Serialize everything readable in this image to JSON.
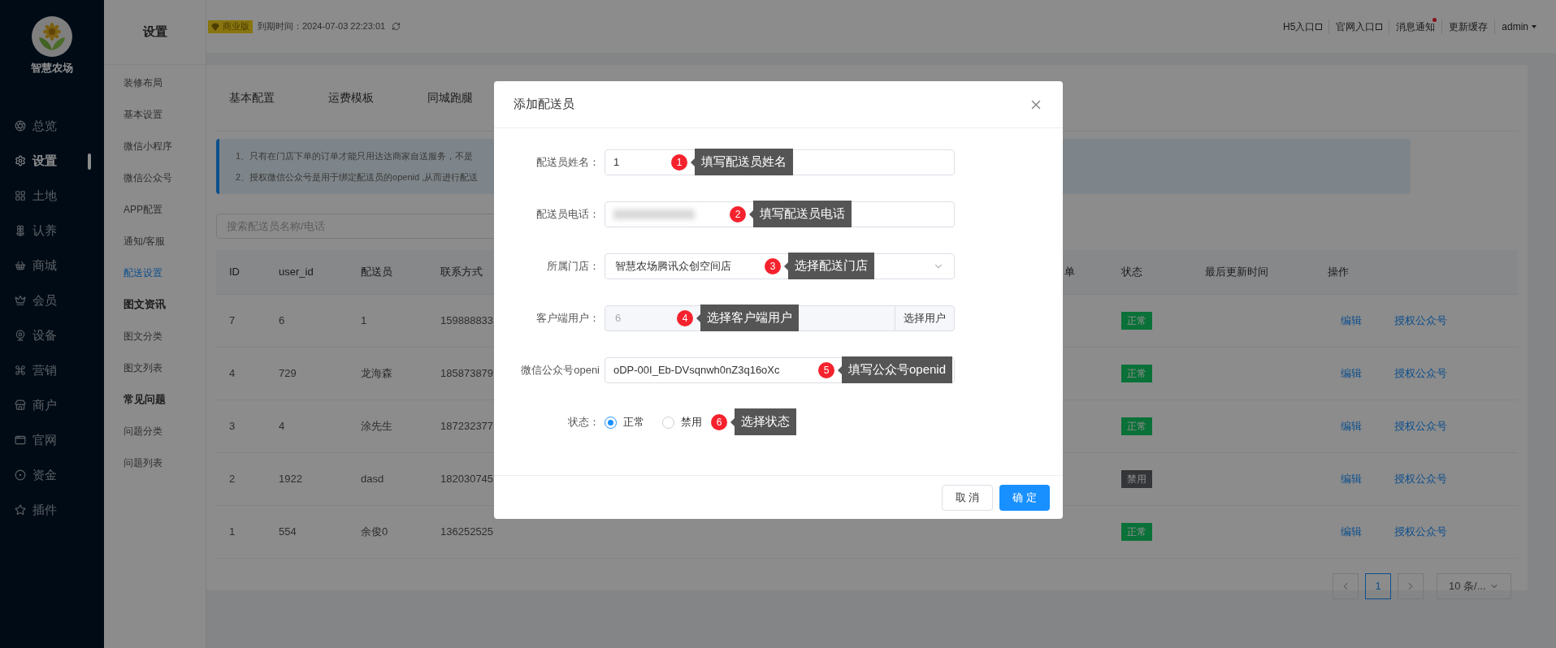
{
  "sidebar": {
    "logo_text": "智慧农场",
    "items": [
      {
        "label": "总览",
        "selected": false
      },
      {
        "label": "设置",
        "selected": true
      },
      {
        "label": "土地",
        "selected": false
      },
      {
        "label": "认养",
        "selected": false
      },
      {
        "label": "商城",
        "selected": false
      },
      {
        "label": "会员",
        "selected": false
      },
      {
        "label": "设备",
        "selected": false
      },
      {
        "label": "营销",
        "selected": false
      },
      {
        "label": "商户",
        "selected": false
      },
      {
        "label": "官网",
        "selected": false
      },
      {
        "label": "资金",
        "selected": false
      },
      {
        "label": "插件",
        "selected": false
      }
    ]
  },
  "submenu": {
    "title": "设置",
    "items": [
      {
        "label": "装修布局",
        "kind": "link",
        "selected": false
      },
      {
        "label": "基本设置",
        "kind": "link",
        "selected": false
      },
      {
        "label": "微信小程序",
        "kind": "link",
        "selected": false
      },
      {
        "label": "微信公众号",
        "kind": "link",
        "selected": false
      },
      {
        "label": "APP配置",
        "kind": "link",
        "selected": false
      },
      {
        "label": "通知/客服",
        "kind": "link",
        "selected": false
      },
      {
        "label": "配送设置",
        "kind": "link",
        "selected": true
      },
      {
        "label": "图文资讯",
        "kind": "heading",
        "selected": false
      },
      {
        "label": "图文分类",
        "kind": "link",
        "selected": false
      },
      {
        "label": "图文列表",
        "kind": "link",
        "selected": false
      },
      {
        "label": "常见问题",
        "kind": "heading",
        "selected": false
      },
      {
        "label": "问题分类",
        "kind": "link",
        "selected": false
      },
      {
        "label": "问题列表",
        "kind": "link",
        "selected": false
      }
    ]
  },
  "top_bar": {
    "edition_badge": "商业版",
    "expiry": "到期时间：2024-07-03 22:23:01",
    "links": [
      {
        "label": "H5入口",
        "kind": "external",
        "dot": false
      },
      {
        "label": "官网入口",
        "kind": "external",
        "dot": false
      },
      {
        "label": "消息通知",
        "kind": "plain",
        "dot": true
      },
      {
        "label": "更新缓存",
        "kind": "plain",
        "dot": false
      }
    ],
    "user": "admin"
  },
  "tabs": [
    {
      "label": "基本配置"
    },
    {
      "label": "运费模板"
    },
    {
      "label": "同城跑腿"
    }
  ],
  "notice": [
    "1、只有在门店下单的订单才能只用达达商家自送服务，不是",
    "2、授权微信公众号是用于绑定配送员的openid ,从而进行配送"
  ],
  "search": {
    "placeholder": "搜索配送员名称/电话"
  },
  "table": {
    "columns": [
      "ID",
      "user_id",
      "配送员",
      "联系方式",
      "单",
      "状态",
      "最后更新时间",
      "操作"
    ],
    "rows": [
      {
        "id": "7",
        "user_id": "6",
        "name": "1",
        "phone": "159888833",
        "status": {
          "label": "正常",
          "kind": "normal"
        },
        "actions": [
          "编辑",
          "授权公众号"
        ]
      },
      {
        "id": "4",
        "user_id": "729",
        "name": "龙海森",
        "phone": "185873879",
        "status": {
          "label": "正常",
          "kind": "normal"
        },
        "actions": [
          "编辑",
          "授权公众号"
        ]
      },
      {
        "id": "3",
        "user_id": "4",
        "name": "涂先生",
        "phone": "187232377",
        "status": {
          "label": "正常",
          "kind": "normal"
        },
        "actions": [
          "编辑",
          "授权公众号"
        ]
      },
      {
        "id": "2",
        "user_id": "1922",
        "name": "dasd",
        "phone": "182030745",
        "status": {
          "label": "禁用",
          "kind": "disabled"
        },
        "actions": [
          "编辑",
          "授权公众号"
        ]
      },
      {
        "id": "1",
        "user_id": "554",
        "name": "余俊0",
        "phone": "136252525",
        "status": {
          "label": "正常",
          "kind": "normal"
        },
        "actions": [
          "编辑",
          "授权公众号"
        ]
      }
    ]
  },
  "pagination": {
    "pages": [
      {
        "label": "1",
        "selected": true
      }
    ],
    "page_size": "10 条/..."
  },
  "modal": {
    "title": "添加配送员",
    "fields": [
      {
        "kind": "text",
        "label": "配送员姓名：",
        "value": "1",
        "annotation": {
          "number": "1",
          "text": "填写配送员姓名"
        }
      },
      {
        "kind": "redacted",
        "label": "配送员电话：",
        "annotation": {
          "number": "2",
          "text": "填写配送员电话"
        }
      },
      {
        "kind": "select",
        "label": "所属门店：",
        "value": "智慧农场腾讯众创空间店",
        "annotation": {
          "number": "3",
          "text": "选择配送门店"
        }
      },
      {
        "kind": "picker",
        "label": "客户端用户：",
        "value": "6",
        "button": "选择用户",
        "annotation": {
          "number": "4",
          "text": "选择客户端用户"
        }
      },
      {
        "kind": "text",
        "label": "微信公众号openi",
        "value": "oDP-00I_Eb-DVsqnwh0nZ3q16oXc",
        "annotation": {
          "number": "5",
          "text": "填写公众号openid"
        }
      },
      {
        "kind": "radio",
        "label": "状态：",
        "options": [
          {
            "label": "正常",
            "selected": true
          },
          {
            "label": "禁用",
            "selected": false
          }
        ],
        "annotation": {
          "number": "6",
          "text": "选择状态"
        }
      }
    ],
    "buttons": [
      {
        "label": "取 消",
        "kind": "default"
      },
      {
        "label": "确 定",
        "kind": "primary"
      }
    ]
  }
}
